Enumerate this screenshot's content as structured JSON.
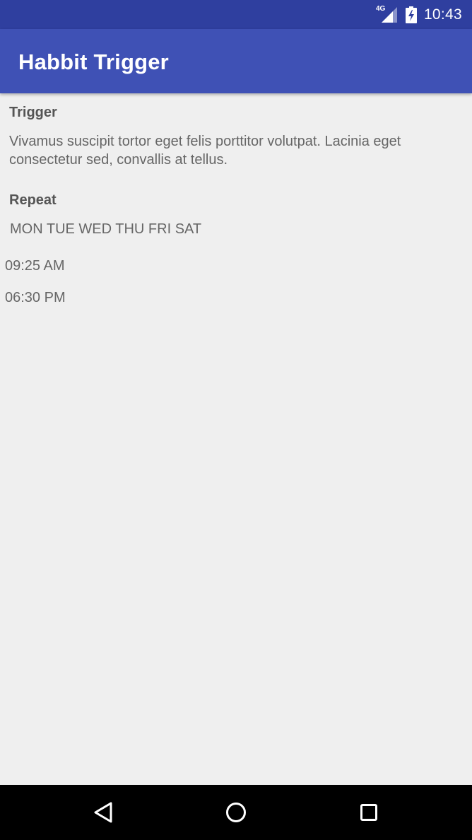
{
  "status_bar": {
    "network_type": "4G",
    "time": "10:43",
    "icons": [
      "signal-icon",
      "battery-charging-icon"
    ]
  },
  "app_bar": {
    "title": "Habbit Trigger"
  },
  "trigger": {
    "label": "Trigger",
    "description": "Vivamus suscipit tortor eget felis porttitor volutpat. Lacinia eget consectetur sed, convallis at tellus."
  },
  "repeat": {
    "label": "Repeat",
    "days": "MON TUE WED THU FRI SAT"
  },
  "times": [
    "09:25 AM",
    "06:30 PM"
  ],
  "nav_bar": {
    "icons": [
      "back-icon",
      "home-icon",
      "recents-icon"
    ]
  },
  "colors": {
    "status_bar": "#2f3f9f",
    "app_bar": "#3f51b5",
    "background": "#efefef",
    "nav_bar": "#000000"
  }
}
